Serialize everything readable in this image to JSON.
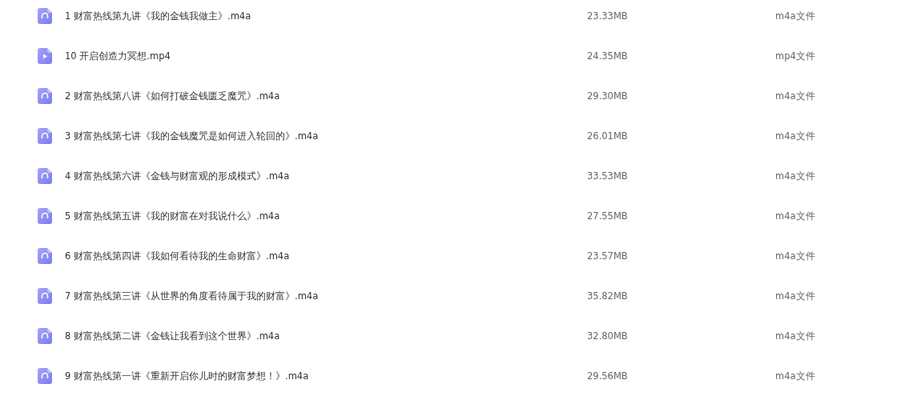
{
  "files": [
    {
      "kind": "audio",
      "name": "1 财富热线第九讲《我的金钱我做主》.m4a",
      "size": "23.33MB",
      "type": "m4a文件"
    },
    {
      "kind": "video",
      "name": "10 开启创造力冥想.mp4",
      "size": "24.35MB",
      "type": "mp4文件"
    },
    {
      "kind": "audio",
      "name": "2 财富热线第八讲《如何打破金钱匮乏魔咒》.m4a",
      "size": "29.30MB",
      "type": "m4a文件"
    },
    {
      "kind": "audio",
      "name": "3 财富热线第七讲《我的金钱魔咒是如何进入轮回的》.m4a",
      "size": "26.01MB",
      "type": "m4a文件"
    },
    {
      "kind": "audio",
      "name": "4 财富热线第六讲《金钱与财富观的形成模式》.m4a",
      "size": "33.53MB",
      "type": "m4a文件"
    },
    {
      "kind": "audio",
      "name": "5 财富热线第五讲《我的财富在对我说什么》.m4a",
      "size": "27.55MB",
      "type": "m4a文件"
    },
    {
      "kind": "audio",
      "name": "6 财富热线第四讲《我如何看待我的生命财富》.m4a",
      "size": "23.57MB",
      "type": "m4a文件"
    },
    {
      "kind": "audio",
      "name": "7 财富热线第三讲《从世界的角度看待属于我的财富》.m4a",
      "size": "35.82MB",
      "type": "m4a文件"
    },
    {
      "kind": "audio",
      "name": "8 财富热线第二讲《金钱让我看到这个世界》.m4a",
      "size": "32.80MB",
      "type": "m4a文件"
    },
    {
      "kind": "audio",
      "name": "9 财富热线第一讲《重新开启你儿时的财富梦想！》.m4a",
      "size": "29.56MB",
      "type": "m4a文件"
    }
  ]
}
